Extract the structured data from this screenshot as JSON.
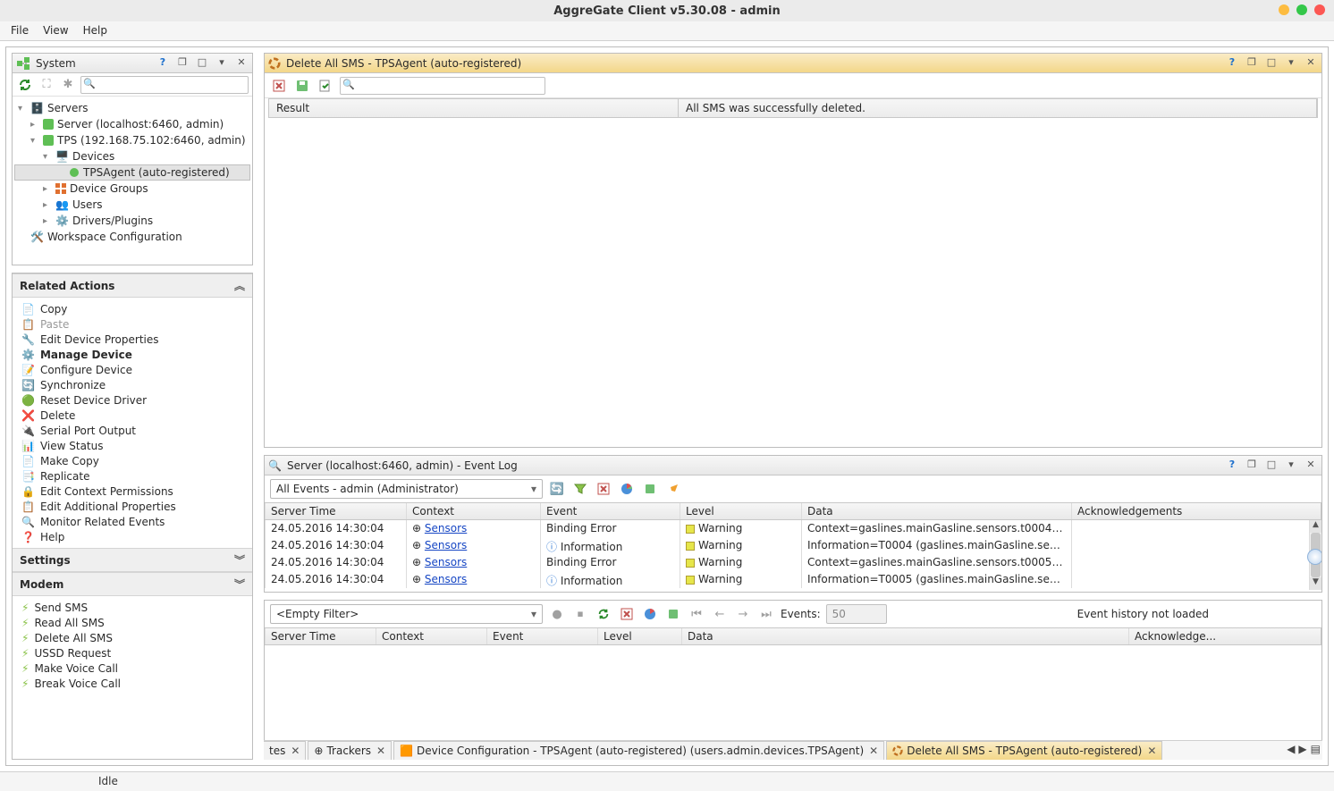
{
  "window": {
    "title": "AggreGate Client v5.30.08 - admin"
  },
  "menubar": {
    "file": "File",
    "view": "View",
    "help": "Help"
  },
  "system_panel": {
    "title": "System",
    "search_placeholder": "",
    "tree": {
      "servers": "Servers",
      "server1": "Server (localhost:6460, admin)",
      "tps": "TPS (192.168.75.102:6460, admin)",
      "devices": "Devices",
      "tpsagent": "TPSAgent (auto-registered)",
      "device_groups": "Device Groups",
      "users": "Users",
      "drivers": "Drivers/Plugins",
      "workspace": "Workspace Configuration"
    }
  },
  "related_actions": {
    "title": "Related Actions",
    "items": {
      "copy": "Copy",
      "paste": "Paste",
      "edit_props": "Edit Device Properties",
      "manage": "Manage Device",
      "configure": "Configure Device",
      "sync": "Synchronize",
      "reset": "Reset Device Driver",
      "delete": "Delete",
      "serial": "Serial Port Output",
      "view_status": "View Status",
      "make_copy": "Make Copy",
      "replicate": "Replicate",
      "ctx_perm": "Edit Context Permissions",
      "add_props": "Edit Additional Properties",
      "monitor": "Monitor Related Events",
      "help": "Help"
    }
  },
  "settings": {
    "title": "Settings"
  },
  "modem": {
    "title": "Modem",
    "items": {
      "send": "Send SMS",
      "read": "Read All SMS",
      "delete": "Delete All SMS",
      "ussd": "USSD Request",
      "voice": "Make Voice Call",
      "break": "Break Voice Call"
    }
  },
  "delete_panel": {
    "title": "Delete All SMS - TPSAgent (auto-registered)",
    "result_header": "Result",
    "result_msg": "All SMS was successfully deleted."
  },
  "tabs": {
    "t0_frag": "tes",
    "t1": "Trackers",
    "t2": "Device Configuration - TPSAgent (auto-registered) (users.admin.devices.TPSAgent)",
    "t3": "Delete All SMS - TPSAgent (auto-registered)"
  },
  "eventlog": {
    "title": "Server (localhost:6460, admin) - Event Log",
    "filter": "All Events - admin (Administrator)",
    "columns": {
      "time": "Server Time",
      "ctx": "Context",
      "event": "Event",
      "level": "Level",
      "data": "Data",
      "ack": "Acknowledgements"
    },
    "rows": [
      {
        "time": "24.05.2016 14:30:04",
        "ctx": "Sensors",
        "event": "Binding Error",
        "level": "Warning",
        "level_kind": "warn",
        "data": "Context=gaslines.mainGasline.sensors.t0004, ..."
      },
      {
        "time": "24.05.2016 14:30:04",
        "ctx": "Sensors",
        "event": "Information",
        "level": "Warning",
        "level_kind": "warn",
        "data": "Information=T0004 (gaslines.mainGasline.sens...",
        "info": true
      },
      {
        "time": "24.05.2016 14:30:04",
        "ctx": "Sensors",
        "event": "Binding Error",
        "level": "Warning",
        "level_kind": "warn",
        "data": "Context=gaslines.mainGasline.sensors.t0005, ..."
      },
      {
        "time": "24.05.2016 14:30:04",
        "ctx": "Sensors",
        "event": "Information",
        "level": "Warning",
        "level_kind": "warn",
        "data": "Information=T0005 (gaslines.mainGasline.sens...",
        "info": true
      }
    ]
  },
  "eventfilter": {
    "filter": "<Empty Filter>",
    "events_label": "Events:",
    "events_value": "50",
    "not_loaded": "Event history not loaded",
    "columns": {
      "time": "Server Time",
      "ctx": "Context",
      "event": "Event",
      "level": "Level",
      "data": "Data",
      "ack": "Acknowledge..."
    }
  },
  "status": {
    "text": "Idle"
  }
}
